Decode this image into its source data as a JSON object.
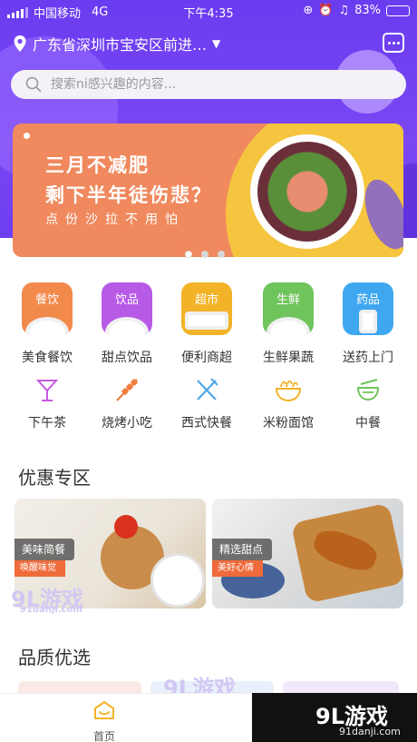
{
  "status": {
    "carrier": "中国移动",
    "network": "4G",
    "time": "下午4:35",
    "battery": "83%",
    "battery_level": 0.83
  },
  "header": {
    "location": "广东省深圳市宝安区前进…",
    "search_placeholder": "搜索ni感兴趣的内容..."
  },
  "banner": {
    "line1": "三月不减肥",
    "line2": "剩下半年徒伤悲？",
    "line3": "点份沙拉不用怕",
    "page_count": 3,
    "active_page": 1
  },
  "categories_top": [
    {
      "tag": "餐饮",
      "label": "美食餐饮",
      "color": "#f28a4b"
    },
    {
      "tag": "饮品",
      "label": "甜点饮品",
      "color": "#b75ae6"
    },
    {
      "tag": "超市",
      "label": "便利商超",
      "color": "#f3b328"
    },
    {
      "tag": "生鲜",
      "label": "生鲜果蔬",
      "color": "#6fc45c"
    },
    {
      "tag": "药品",
      "label": "送药上门",
      "color": "#3fa7ef"
    }
  ],
  "categories_bottom": [
    {
      "label": "下午茶",
      "icon": "cocktail-icon",
      "color": "#c45be0"
    },
    {
      "label": "烧烤小吃",
      "icon": "skewer-icon",
      "color": "#f07a3a"
    },
    {
      "label": "西式快餐",
      "icon": "fork-knife-icon",
      "color": "#4fa8e8"
    },
    {
      "label": "米粉面馆",
      "icon": "noodle-bowl-icon",
      "color": "#f3b328"
    },
    {
      "label": "中餐",
      "icon": "chinese-bowl-icon",
      "color": "#6fc45c"
    }
  ],
  "promo_section": {
    "title": "优惠专区",
    "cards": [
      {
        "name": "美味简餐",
        "sub": "唤醒味觉"
      },
      {
        "name": "精选甜点",
        "sub": "美好心情"
      }
    ]
  },
  "quality_section": {
    "title": "品质优选"
  },
  "tabbar": {
    "home_label": "首页"
  },
  "watermarks": {
    "logo": "9L游戏",
    "site": "91danji.com"
  }
}
